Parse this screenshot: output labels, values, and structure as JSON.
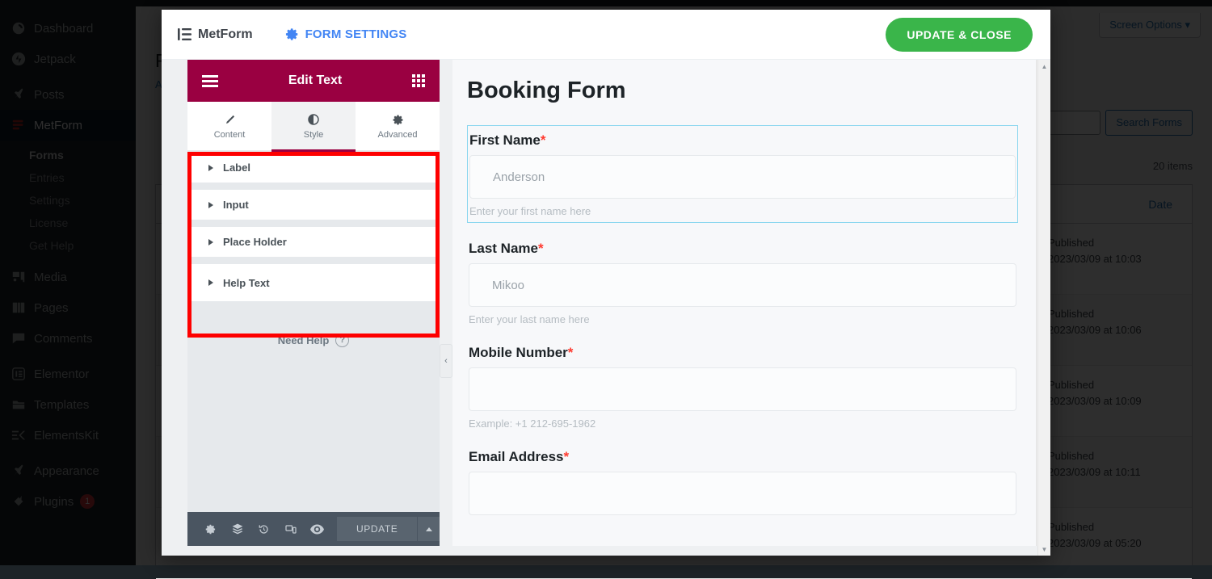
{
  "wp": {
    "sidebar": {
      "items": [
        {
          "label": "Dashboard",
          "icon": "dashboard-icon",
          "current": false
        },
        {
          "label": "Jetpack",
          "icon": "jetpack-icon",
          "current": false
        },
        {
          "label": "Posts",
          "icon": "pin-icon",
          "current": false
        },
        {
          "label": "MetForm",
          "icon": "metform-icon",
          "current": true
        },
        {
          "label": "Media",
          "icon": "media-icon",
          "current": false
        },
        {
          "label": "Pages",
          "icon": "pages-icon",
          "current": false
        },
        {
          "label": "Comments",
          "icon": "comments-icon",
          "current": false
        },
        {
          "label": "Elementor",
          "icon": "elementor-icon",
          "current": false
        },
        {
          "label": "Templates",
          "icon": "folder-icon",
          "current": false
        },
        {
          "label": "ElementsKit",
          "icon": "elementskit-icon",
          "current": false
        },
        {
          "label": "Appearance",
          "icon": "brush-icon",
          "current": false
        },
        {
          "label": "Plugins",
          "icon": "plug-icon",
          "current": false,
          "badge": "1"
        }
      ],
      "submenu": [
        {
          "label": "Forms",
          "current": true
        },
        {
          "label": "Entries",
          "current": false
        },
        {
          "label": "Settings",
          "current": false
        },
        {
          "label": "License",
          "current": false
        },
        {
          "label": "Get Help",
          "current": false
        }
      ]
    },
    "screen_options": "Screen Options",
    "page_title": "Forms",
    "subnav": "All",
    "search_placeholder": "",
    "search_button": "Search Forms",
    "items_count": "20 items",
    "table": {
      "columns": [
        "Date"
      ],
      "rows": [
        {
          "status": "Published",
          "date": "2023/03/09 at 10:03"
        },
        {
          "status": "Published",
          "date": "2023/03/09 at 10:06"
        },
        {
          "status": "Published",
          "date": "2023/03/09 at 10:09"
        },
        {
          "status": "Published",
          "date": "2023/03/09 at 10:11"
        },
        {
          "status": "Published",
          "date": "2023/03/09 at 05:20"
        }
      ]
    }
  },
  "modal": {
    "brand": "MetForm",
    "form_settings": "FORM SETTINGS",
    "update_close": "UPDATE & CLOSE"
  },
  "panel": {
    "header_title": "Edit Text",
    "tabs": [
      {
        "label": "Content",
        "icon": "pencil-icon",
        "active": false
      },
      {
        "label": "Style",
        "icon": "contrast-icon",
        "active": true
      },
      {
        "label": "Advanced",
        "icon": "gear-icon",
        "active": false
      }
    ],
    "sections": [
      {
        "label": "Label"
      },
      {
        "label": "Input"
      },
      {
        "label": "Place Holder"
      },
      {
        "label": "Help Text"
      }
    ],
    "need_help": "Need Help",
    "footer": {
      "icons": [
        "settings-icon",
        "layers-icon",
        "history-icon",
        "responsive-icon",
        "preview-icon"
      ],
      "update_label": "UPDATE"
    },
    "accent_color": "#9a0041",
    "highlight_color": "#fe0000"
  },
  "preview": {
    "form_title": "Booking Form",
    "fields": [
      {
        "label": "First Name",
        "required": "*",
        "value": "Anderson",
        "help": "Enter your first name here",
        "selected": true
      },
      {
        "label": "Last Name",
        "required": "*",
        "value": "Mikoo",
        "help": "Enter your last name here",
        "selected": false
      },
      {
        "label": "Mobile Number",
        "required": "*",
        "value": "",
        "help": "Example: +1 212-695-1962",
        "selected": false
      },
      {
        "label": "Email Address",
        "required": "*",
        "value": "",
        "help": "",
        "selected": false
      }
    ]
  }
}
